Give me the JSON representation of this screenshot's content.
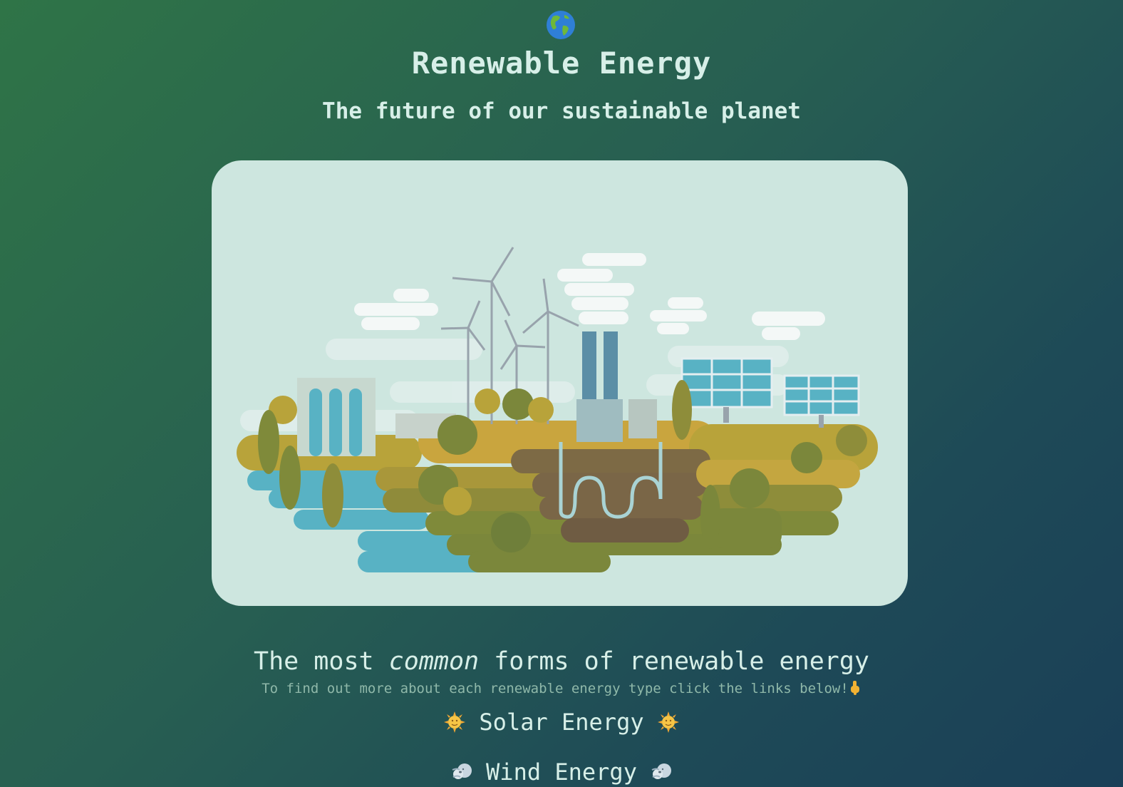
{
  "header": {
    "icon": "globe-americas-icon",
    "title": "Renewable Energy",
    "subtitle": "The future of our sustainable planet"
  },
  "hero": {
    "image": "renewable-energy-illustration"
  },
  "section": {
    "title_before": "The most ",
    "title_emphasis": "common",
    "title_after": " forms of renewable energy",
    "hint": "To find out more about each renewable energy type click the links below!"
  },
  "links": [
    {
      "label": "Solar Energy",
      "icon": "sun-face-icon"
    },
    {
      "label": "Wind Energy",
      "icon": "wind-face-icon"
    }
  ],
  "colors": {
    "text": "#d7efe8",
    "hint": "#8fb8a9",
    "card": "#cde6df"
  }
}
